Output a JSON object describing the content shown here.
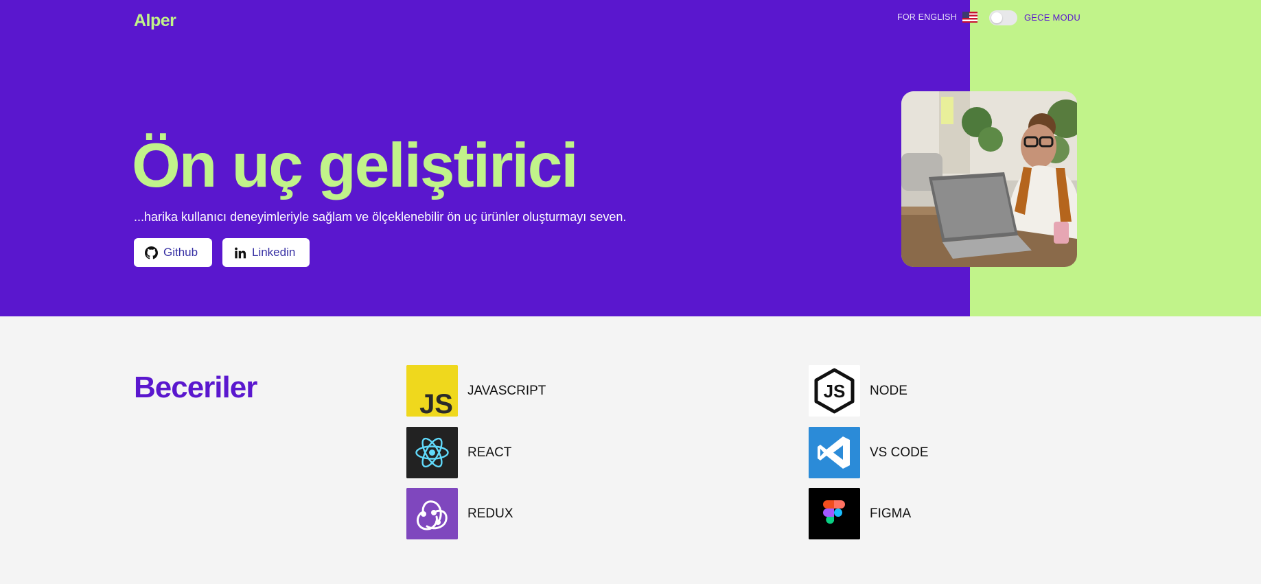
{
  "header": {
    "logo": "Alper",
    "language_label": "FOR ENGLISH",
    "dark_mode_label": "GECE MODU"
  },
  "hero": {
    "headline": "Ön uç geliştirici",
    "tagline": "...harika kullanıcı deneyimleriyle sağlam ve ölçeklenebilir ön uç ürünler oluşturmayı seven.",
    "buttons": {
      "github": "Github",
      "linkedin": "Linkedin"
    }
  },
  "skills": {
    "title": "Beceriler",
    "items": [
      {
        "label": "JAVASCRIPT",
        "icon": "javascript-icon",
        "color": "#efd81d"
      },
      {
        "label": "REACT",
        "icon": "react-icon",
        "color": "#222222"
      },
      {
        "label": "REDUX",
        "icon": "redux-icon",
        "color": "#7f47be"
      },
      {
        "label": "NODE",
        "icon": "nodejs-icon",
        "color": "#ffffff"
      },
      {
        "label": "VS CODE",
        "icon": "vscode-icon",
        "color": "#2b8bd8"
      },
      {
        "label": "FIGMA",
        "icon": "figma-icon",
        "color": "#000000"
      }
    ]
  },
  "colors": {
    "primary_purple": "#5a17ce",
    "accent_green": "#c1f38a",
    "background": "#f4f4f4"
  }
}
